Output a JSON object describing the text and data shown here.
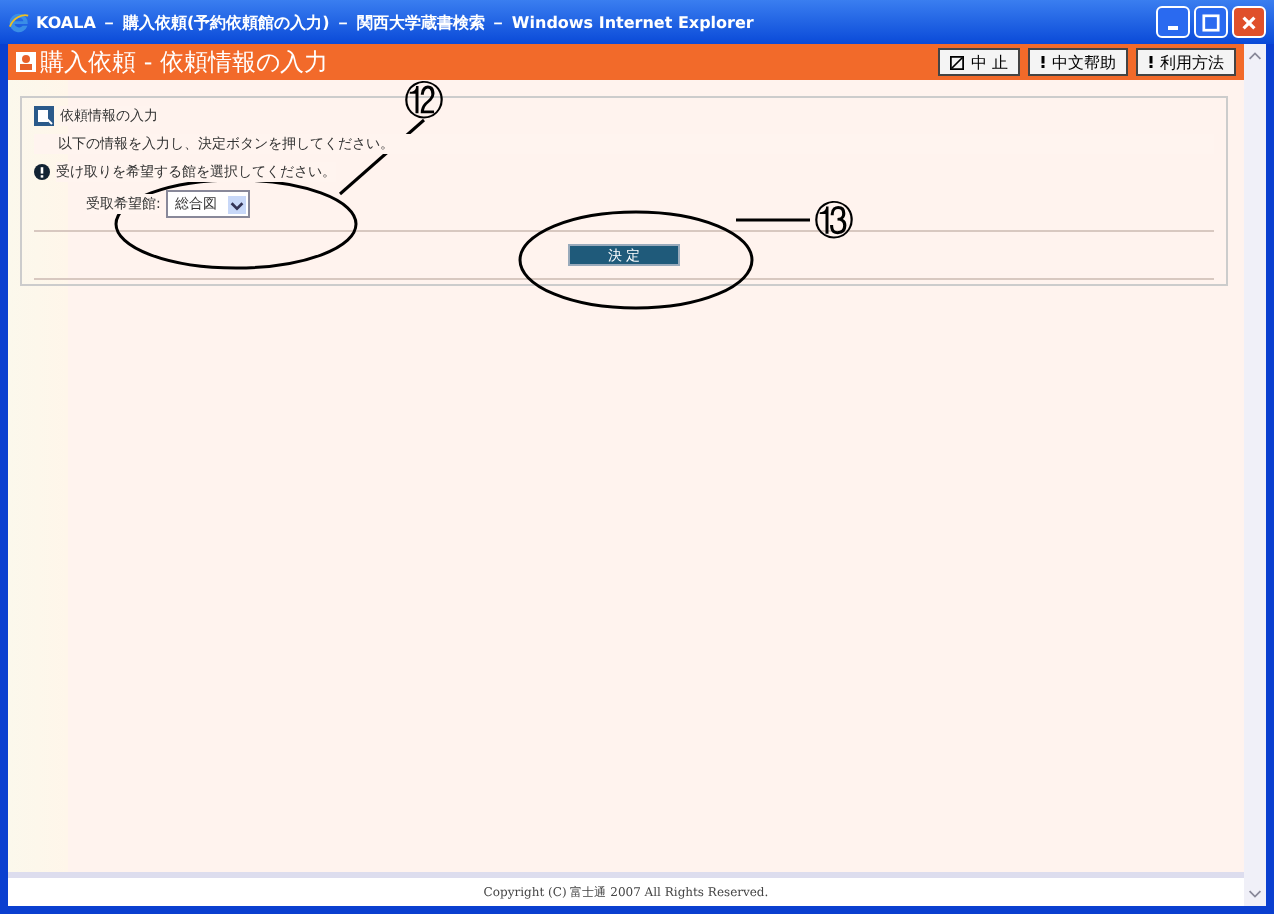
{
  "window": {
    "title": "KOALA － 購入依頼(予約依頼館の入力) － 関西大学蔵書検索 － Windows Internet Explorer"
  },
  "header": {
    "title": "購入依頼 - 依頼情報の入力",
    "buttons": [
      {
        "label": "中 止",
        "kind": "stop"
      },
      {
        "label": "中文帮助",
        "kind": "info"
      },
      {
        "label": "利用方法",
        "kind": "info"
      }
    ]
  },
  "section": {
    "title": "依頼情報の入力",
    "instruction": "以下の情報を入力し、決定ボタンを押してください。",
    "hint": "受け取りを希望する館を選択してください。",
    "field_label": "受取希望館:",
    "library_select": {
      "value": "総合図"
    },
    "submit": "決 定"
  },
  "callouts": [
    {
      "number": "⑫"
    },
    {
      "number": "⑬"
    }
  ],
  "footer": {
    "copyright": "Copyright (C) 富士通 2007 All Rights Reserved."
  }
}
